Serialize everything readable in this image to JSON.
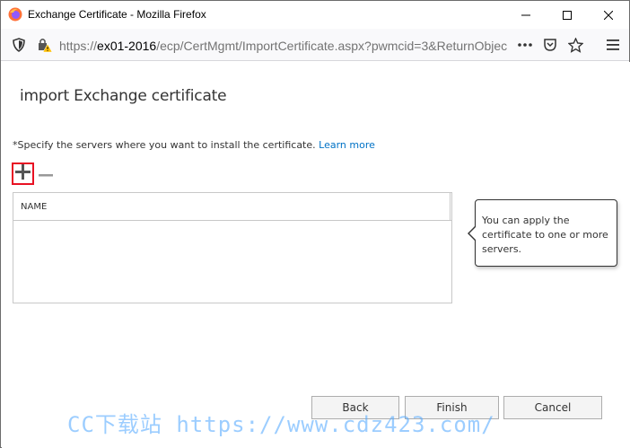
{
  "window": {
    "title": "Exchange Certificate - Mozilla Firefox"
  },
  "browser": {
    "url_prefix": "https://",
    "url_host": "ex01-2016",
    "url_path": "/ecp/CertMgmt/ImportCertificate.aspx?pwmcid=3&ReturnObjec"
  },
  "page": {
    "title": "import Exchange certificate",
    "instruction": "*Specify the servers where you want to install the certificate.",
    "learn_more": "Learn more"
  },
  "servers_table": {
    "columns": [
      "NAME"
    ],
    "rows": []
  },
  "callout": {
    "text": "You can apply the certificate to one or more servers."
  },
  "buttons": {
    "back": "Back",
    "finish": "Finish",
    "cancel": "Cancel"
  },
  "watermark": {
    "text": "CC下载站 https://www.cdz423.com/"
  },
  "icons": {
    "add": "plus-icon",
    "remove": "minus-icon"
  },
  "colors": {
    "link": "#0072c6",
    "highlight_border": "#e81123"
  }
}
